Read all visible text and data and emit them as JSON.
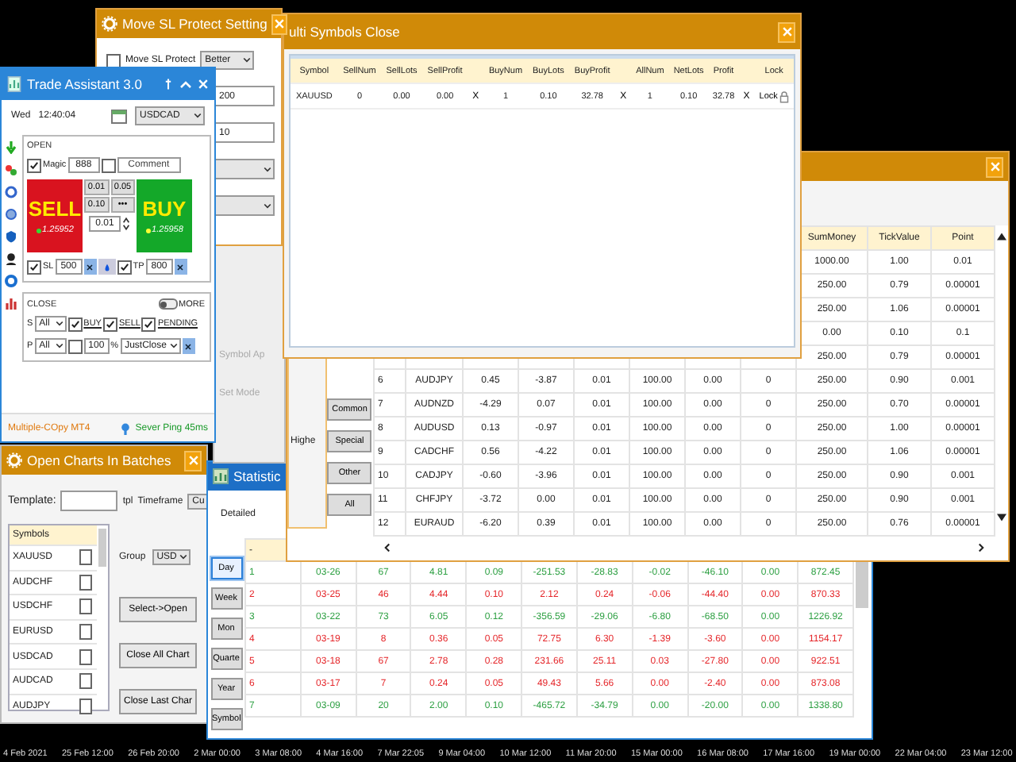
{
  "chart_axis": {
    "labels": [
      "4 Feb 2021",
      "25 Feb 12:00",
      "26 Feb 20:00",
      "2 Mar 00:00",
      "3 Mar 08:00",
      "4 Mar 16:00",
      "7 Mar 22:05",
      "9 Mar 04:00",
      "10 Mar 12:00",
      "11 Mar 20:00",
      "15 Mar 00:00",
      "16 Mar 08:00",
      "17 Mar 16:00",
      "19 Mar 00:00",
      "22 Mar 04:00",
      "23 Mar 12:00"
    ]
  },
  "symbol_window": {
    "side_label": "Highe",
    "groups": [
      "Common",
      "Special",
      "Other",
      "All"
    ],
    "columns": [
      "SumMoney",
      "TickValue",
      "Point"
    ],
    "rows": [
      [
        "1000.00",
        "1.00",
        "0.01"
      ],
      [
        "250.00",
        "0.79",
        "0.00001"
      ],
      [
        "250.00",
        "1.06",
        "0.00001"
      ],
      [
        "0.00",
        "0.10",
        "0.1"
      ],
      [
        "250.00",
        "0.79",
        "0.00001"
      ],
      [
        "6",
        "AUDJPY",
        "0.45",
        "-3.87",
        "0.01",
        "100.00",
        "0.00",
        "0",
        "250.00",
        "0.90",
        "0.001"
      ],
      [
        "7",
        "AUDNZD",
        "-4.29",
        "0.07",
        "0.01",
        "100.00",
        "0.00",
        "0",
        "250.00",
        "0.70",
        "0.00001"
      ],
      [
        "8",
        "AUDUSD",
        "0.13",
        "-0.97",
        "0.01",
        "100.00",
        "0.00",
        "0",
        "250.00",
        "1.00",
        "0.00001"
      ],
      [
        "9",
        "CADCHF",
        "0.56",
        "-4.22",
        "0.01",
        "100.00",
        "0.00",
        "0",
        "250.00",
        "1.06",
        "0.00001"
      ],
      [
        "10",
        "CADJPY",
        "-0.60",
        "-3.96",
        "0.01",
        "100.00",
        "0.00",
        "0",
        "250.00",
        "0.90",
        "0.001"
      ],
      [
        "11",
        "CHFJPY",
        "-3.72",
        "0.00",
        "0.01",
        "100.00",
        "0.00",
        "0",
        "250.00",
        "0.90",
        "0.001"
      ],
      [
        "12",
        "EURAUD",
        "-6.20",
        "0.39",
        "0.01",
        "100.00",
        "0.00",
        "0",
        "250.00",
        "0.76",
        "0.00001"
      ]
    ]
  },
  "multi_close_window": {
    "title": "ulti Symbols Close",
    "columns": [
      {
        "kind": "data",
        "label": "Symbol"
      },
      {
        "kind": "data",
        "label": "SellNum"
      },
      {
        "kind": "data",
        "label": "SellLots"
      },
      {
        "kind": "data",
        "label": "SellProfit"
      },
      {
        "kind": "action"
      },
      {
        "kind": "data",
        "label": "BuyNum"
      },
      {
        "kind": "data",
        "label": "BuyLots"
      },
      {
        "kind": "data",
        "label": "BuyProfit"
      },
      {
        "kind": "action"
      },
      {
        "kind": "data",
        "label": "AllNum"
      },
      {
        "kind": "data",
        "label": "NetLots"
      },
      {
        "kind": "data",
        "label": "Profit"
      },
      {
        "kind": "action"
      },
      {
        "kind": "data",
        "label": "Lock"
      }
    ],
    "rows": [
      [
        "XAUUSD",
        "0",
        "0.00",
        "0.00",
        "X",
        "1",
        "0.10",
        "32.78",
        "X",
        "1",
        "0.10",
        "32.78",
        "X",
        "Lock"
      ]
    ]
  },
  "move_sl_window": {
    "title": "Move SL Protect Setting",
    "protect": {
      "label": "Move SL Protect",
      "checked": false
    },
    "mode": "Better",
    "fields": [
      "200",
      "10"
    ]
  },
  "settings_panel": {
    "labels": [
      "Symbol Ap",
      "Set Mode"
    ]
  },
  "trade_assistant": {
    "title": "Trade Assistant 3.0",
    "day": "Wed",
    "time": "12:40:04",
    "symbol": "USDCAD",
    "open": {
      "label": "OPEN",
      "magic": {
        "label": "Magic",
        "checked": true,
        "value": "888"
      },
      "comment": {
        "checked": false,
        "placeholder": "Comment"
      },
      "sell": {
        "label": "SELL",
        "price": "1.25952"
      },
      "buy": {
        "label": "BUY",
        "price": "1.25958"
      },
      "lot_buttons": [
        "0.01",
        "0.05",
        "0.10",
        "•••"
      ],
      "lots": "0.01",
      "sl": {
        "label": "SL",
        "checked": true,
        "value": "500"
      },
      "tp": {
        "label": "TP",
        "checked": true,
        "value": "800"
      }
    },
    "close": {
      "label": "CLOSE",
      "more": {
        "label": "MORE",
        "on": false
      },
      "s_row": {
        "label": "S",
        "select": "All",
        "options": [
          {
            "label": "BUY",
            "checked": true
          },
          {
            "label": "SELL",
            "checked": true
          },
          {
            "label": "PENDING",
            "checked": true
          }
        ]
      },
      "p_row": {
        "label": "P",
        "select": "All",
        "percent_checked": false,
        "percent": "100",
        "percent_sign": "%",
        "mode": "JustClose"
      }
    },
    "footer": {
      "left": "Multiple-COpy MT4",
      "right": "Sever Ping 45ms"
    }
  },
  "open_charts_window": {
    "title": "Open Charts In Batches",
    "template_label": "Template:",
    "template_ext": "tpl",
    "timeframe_label": "Timeframe",
    "timeframe": "Cu",
    "list_header": "Symbols",
    "symbols": [
      {
        "name": "XAUUSD",
        "checked": false
      },
      {
        "name": "AUDCHF",
        "checked": false
      },
      {
        "name": "USDCHF",
        "checked": false
      },
      {
        "name": "EURUSD",
        "checked": false
      },
      {
        "name": "USDCAD",
        "checked": false
      },
      {
        "name": "AUDCAD",
        "checked": false
      },
      {
        "name": "AUDJPY",
        "checked": false
      }
    ],
    "group_label": "Group",
    "group": "USD",
    "buttons": [
      "Select->Open",
      "Close All Chart",
      "Close Last Char"
    ]
  },
  "statistics_window": {
    "title": "Statistic",
    "tab": "Detailed",
    "header": "-",
    "periods": [
      {
        "label": "Day",
        "selected": true
      },
      {
        "label": "Week",
        "selected": false
      },
      {
        "label": "Mon",
        "selected": false
      },
      {
        "label": "Quarte",
        "selected": false
      },
      {
        "label": "Year",
        "selected": false
      },
      {
        "label": "Symbol",
        "selected": false
      }
    ],
    "rows": [
      {
        "color": "#2ea043",
        "cells": [
          "1",
          "03-26",
          "67",
          "4.81",
          "0.09",
          "-251.53",
          "-28.83",
          "-0.02",
          "-46.10",
          "0.00",
          "872.45"
        ]
      },
      {
        "color": "#e5262a",
        "cells": [
          "2",
          "03-25",
          "46",
          "4.44",
          "0.10",
          "2.12",
          "0.24",
          "-0.06",
          "-44.40",
          "0.00",
          "870.33"
        ]
      },
      {
        "color": "#2ea043",
        "cells": [
          "3",
          "03-22",
          "73",
          "6.05",
          "0.12",
          "-356.59",
          "-29.06",
          "-6.80",
          "-68.50",
          "0.00",
          "1226.92"
        ]
      },
      {
        "color": "#e5262a",
        "cells": [
          "4",
          "03-19",
          "8",
          "0.36",
          "0.05",
          "72.75",
          "6.30",
          "-1.39",
          "-3.60",
          "0.00",
          "1154.17"
        ]
      },
      {
        "color": "#e5262a",
        "cells": [
          "5",
          "03-18",
          "67",
          "2.78",
          "0.28",
          "231.66",
          "25.11",
          "0.03",
          "-27.80",
          "0.00",
          "922.51"
        ]
      },
      {
        "color": "#e5262a",
        "cells": [
          "6",
          "03-17",
          "7",
          "0.24",
          "0.05",
          "49.43",
          "5.66",
          "0.00",
          "-2.40",
          "0.00",
          "873.08"
        ]
      },
      {
        "color": "#2ea043",
        "cells": [
          "7",
          "03-09",
          "20",
          "2.00",
          "0.10",
          "-465.72",
          "-34.79",
          "0.00",
          "-20.00",
          "0.00",
          "1338.80"
        ]
      }
    ]
  }
}
